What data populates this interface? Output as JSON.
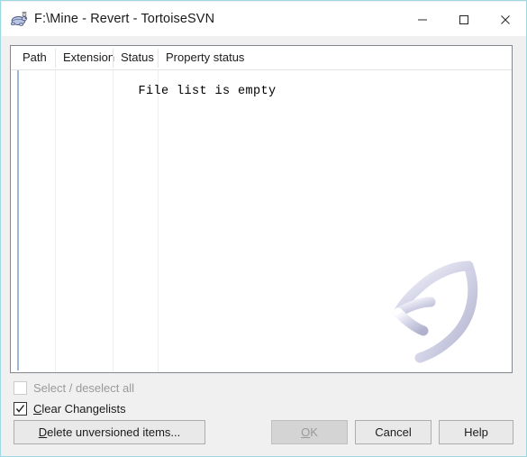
{
  "window": {
    "title": "F:\\Mine - Revert - TortoiseSVN",
    "icon": "tortoisesvn-turtle-icon",
    "border_color": "#9fd8e0",
    "controls": {
      "minimize": "minimize-icon",
      "maximize": "maximize-icon",
      "close": "close-icon"
    }
  },
  "file_list": {
    "columns": [
      {
        "label": "Path"
      },
      {
        "label": "Extension"
      },
      {
        "label": "Status"
      },
      {
        "label": "Property status"
      }
    ],
    "rows": [],
    "empty_message": "File list is empty",
    "watermark": "revert-arrow-watermark"
  },
  "options": {
    "select_deselect_all": {
      "label": "Select / deselect all",
      "accelerator": "a",
      "checked": false,
      "enabled": false
    },
    "clear_changelists": {
      "label": "Clear Changelists",
      "accelerator": "C",
      "checked": true,
      "enabled": true
    }
  },
  "buttons": {
    "delete_unversioned": {
      "label": "Delete unversioned items...",
      "accelerator": "D",
      "enabled": true
    },
    "ok": {
      "label": "OK",
      "accelerator": "O",
      "enabled": false
    },
    "cancel": {
      "label": "Cancel",
      "enabled": true
    },
    "help": {
      "label": "Help",
      "enabled": true
    }
  }
}
